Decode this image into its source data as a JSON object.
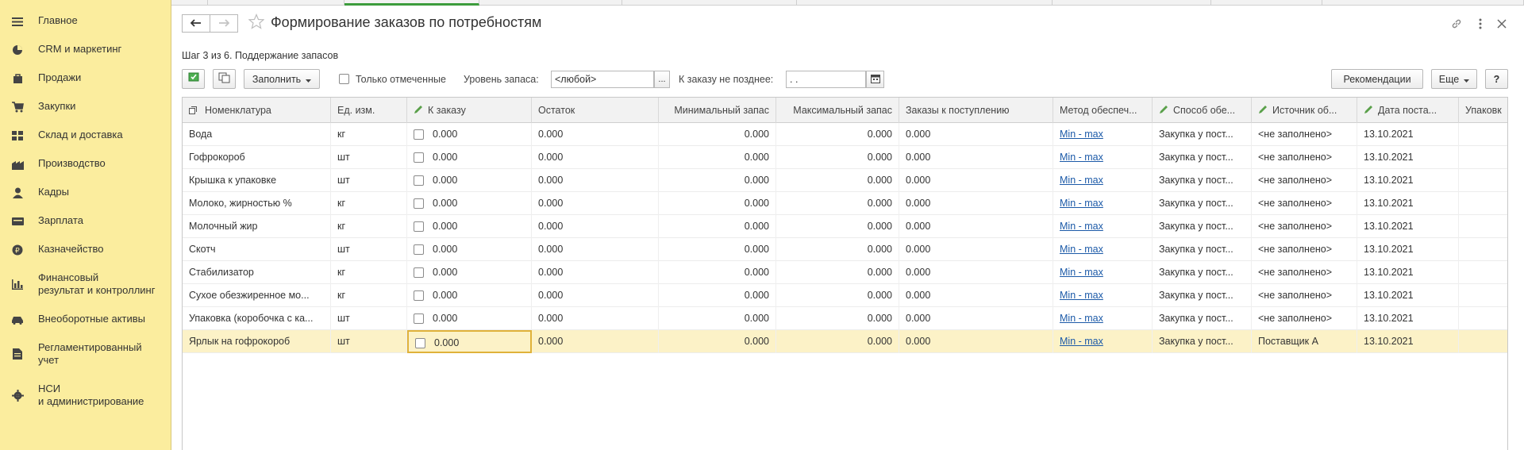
{
  "sidebar": {
    "items": [
      {
        "label": "Главное",
        "icon": "menu-icon"
      },
      {
        "label": "CRM и маркетинг",
        "icon": "pie-chart-icon"
      },
      {
        "label": "Продажи",
        "icon": "bag-icon"
      },
      {
        "label": "Закупки",
        "icon": "cart-icon"
      },
      {
        "label": "Склад и доставка",
        "icon": "warehouse-icon"
      },
      {
        "label": "Производство",
        "icon": "factory-icon"
      },
      {
        "label": "Кадры",
        "icon": "person-icon"
      },
      {
        "label": "Зарплата",
        "icon": "wallet-icon"
      },
      {
        "label": "Казначейство",
        "icon": "coin-icon"
      },
      {
        "label": "Финансовый\nрезультат и контроллинг",
        "icon": "bar-chart-icon"
      },
      {
        "label": "Внеоборотные активы",
        "icon": "car-icon"
      },
      {
        "label": "Регламентированный\nучет",
        "icon": "document-icon"
      },
      {
        "label": "НСИ\nи администрирование",
        "icon": "gear-icon"
      }
    ]
  },
  "header": {
    "title": "Формирование заказов по потребностям",
    "step": "Шаг 3 из 6. Поддержание запасов"
  },
  "toolbar": {
    "fill_label": "Заполнить",
    "only_marked_label": "Только отмеченные",
    "stock_level_label": "Уровень запаса:",
    "stock_level_value": "<любой>",
    "order_by_label": "К заказу не позднее:",
    "order_by_value": " .  .",
    "recommendations_label": "Рекомендации",
    "more_label": "Еще",
    "help_label": "?"
  },
  "table": {
    "columns": {
      "nomenclature": "Номенклатура",
      "unit": "Ед. изм.",
      "to_order": "К заказу",
      "remainder": "Остаток",
      "min_stock": "Минимальный запас",
      "max_stock": "Максимальный запас",
      "incoming": "Заказы к поступлению",
      "method": "Метод обеспеч...",
      "way": "Способ обе...",
      "source": "Источник об...",
      "date": "Дата поста...",
      "pack": "Упаковк"
    },
    "rows": [
      {
        "name": "Вода",
        "unit": "кг",
        "to_order": "0.000",
        "remainder": "0.000",
        "min": "0.000",
        "max": "0.000",
        "incoming": "0.000",
        "method": "Min - max",
        "way": "Закупка у пост...",
        "source": "<не заполнено>",
        "date": "13.10.2021"
      },
      {
        "name": "Гофрокороб",
        "unit": "шт",
        "to_order": "0.000",
        "remainder": "0.000",
        "min": "0.000",
        "max": "0.000",
        "incoming": "0.000",
        "method": "Min - max",
        "way": "Закупка у пост...",
        "source": "<не заполнено>",
        "date": "13.10.2021"
      },
      {
        "name": "Крышка к упаковке",
        "unit": "шт",
        "to_order": "0.000",
        "remainder": "0.000",
        "min": "0.000",
        "max": "0.000",
        "incoming": "0.000",
        "method": "Min - max",
        "way": "Закупка у пост...",
        "source": "<не заполнено>",
        "date": "13.10.2021"
      },
      {
        "name": "Молоко, жирностью %",
        "unit": "кг",
        "to_order": "0.000",
        "remainder": "0.000",
        "min": "0.000",
        "max": "0.000",
        "incoming": "0.000",
        "method": "Min - max",
        "way": "Закупка у пост...",
        "source": "<не заполнено>",
        "date": "13.10.2021"
      },
      {
        "name": "Молочный жир",
        "unit": "кг",
        "to_order": "0.000",
        "remainder": "0.000",
        "min": "0.000",
        "max": "0.000",
        "incoming": "0.000",
        "method": "Min - max",
        "way": "Закупка у пост...",
        "source": "<не заполнено>",
        "date": "13.10.2021"
      },
      {
        "name": "Скотч",
        "unit": "шт",
        "to_order": "0.000",
        "remainder": "0.000",
        "min": "0.000",
        "max": "0.000",
        "incoming": "0.000",
        "method": "Min - max",
        "way": "Закупка у пост...",
        "source": "<не заполнено>",
        "date": "13.10.2021"
      },
      {
        "name": "Стабилизатор",
        "unit": "кг",
        "to_order": "0.000",
        "remainder": "0.000",
        "min": "0.000",
        "max": "0.000",
        "incoming": "0.000",
        "method": "Min - max",
        "way": "Закупка у пост...",
        "source": "<не заполнено>",
        "date": "13.10.2021"
      },
      {
        "name": "Сухое обезжиренное мо...",
        "unit": "кг",
        "to_order": "0.000",
        "remainder": "0.000",
        "min": "0.000",
        "max": "0.000",
        "incoming": "0.000",
        "method": "Min - max",
        "way": "Закупка у пост...",
        "source": "<не заполнено>",
        "date": "13.10.2021"
      },
      {
        "name": "Упаковка (коробочка с ка...",
        "unit": "шт",
        "to_order": "0.000",
        "remainder": "0.000",
        "min": "0.000",
        "max": "0.000",
        "incoming": "0.000",
        "method": "Min - max",
        "way": "Закупка у пост...",
        "source": "<не заполнено>",
        "date": "13.10.2021"
      },
      {
        "name": "Ярлык на гофрокороб",
        "unit": "шт",
        "to_order": "0.000",
        "remainder": "0.000",
        "min": "0.000",
        "max": "0.000",
        "incoming": "0.000",
        "method": "Min - max",
        "way": "Закупка у пост...",
        "source": "Поставщик А",
        "date": "13.10.2021"
      }
    ]
  },
  "colors": {
    "sidebar_bg": "#fbed9e",
    "selected_row": "#fcf2c7",
    "link": "#1c5aa8",
    "focus_border": "#e0b23a"
  }
}
